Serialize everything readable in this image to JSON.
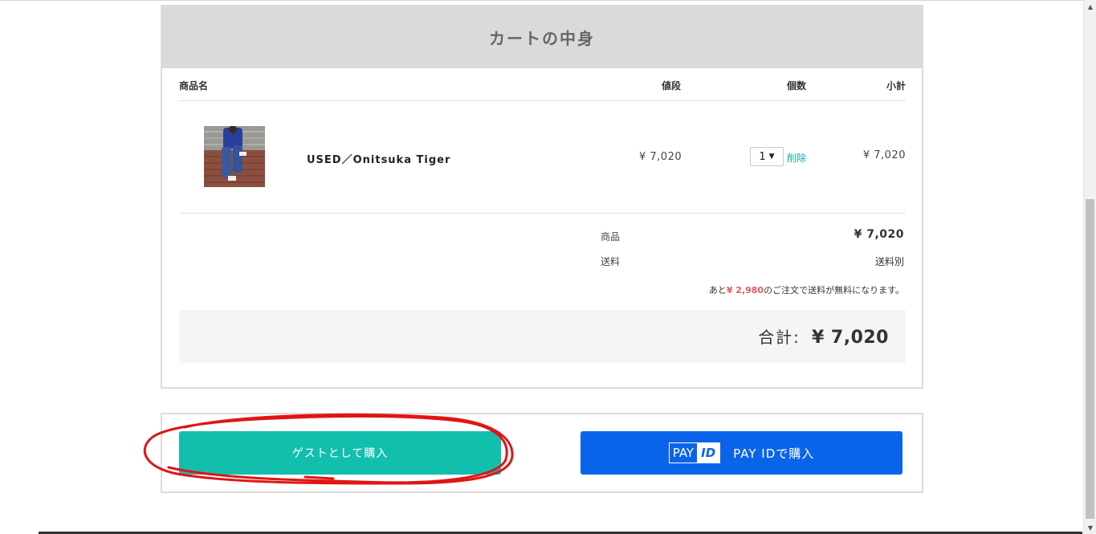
{
  "cart": {
    "title": "カートの中身",
    "columns": {
      "name": "商品名",
      "price": "値段",
      "quantity": "個数",
      "subtotal": "小計"
    },
    "items": [
      {
        "name": "USED／Onitsuka Tiger",
        "price": "¥ 7,020",
        "quantity": "1",
        "delete_label": "削除",
        "subtotal": "¥ 7,020"
      }
    ],
    "summary": {
      "products_label": "商品",
      "products_value": "¥ 7,020",
      "shipping_label": "送料",
      "shipping_value": "送料別",
      "free_shipping_prefix": "あと",
      "free_shipping_amount": "¥ 2,980",
      "free_shipping_suffix": "のご注文で送料が無料になります。"
    },
    "total": {
      "label": "合計:",
      "value": "¥ 7,020"
    }
  },
  "actions": {
    "guest_label": "ゲストとして購入",
    "payid_logo_pay": "PAY",
    "payid_logo_id": "ID",
    "payid_label": "PAY IDで購入"
  },
  "colors": {
    "guest_button": "#12bfad",
    "payid_button": "#0a64ea",
    "header_bg": "#dadada",
    "delete_link": "#1aa9a0",
    "free_amount": "#e85a5a",
    "annotation": "#e01515"
  },
  "scrollbar": {
    "up_icon": "triangle-up-icon",
    "down_icon": "triangle-down-icon"
  }
}
